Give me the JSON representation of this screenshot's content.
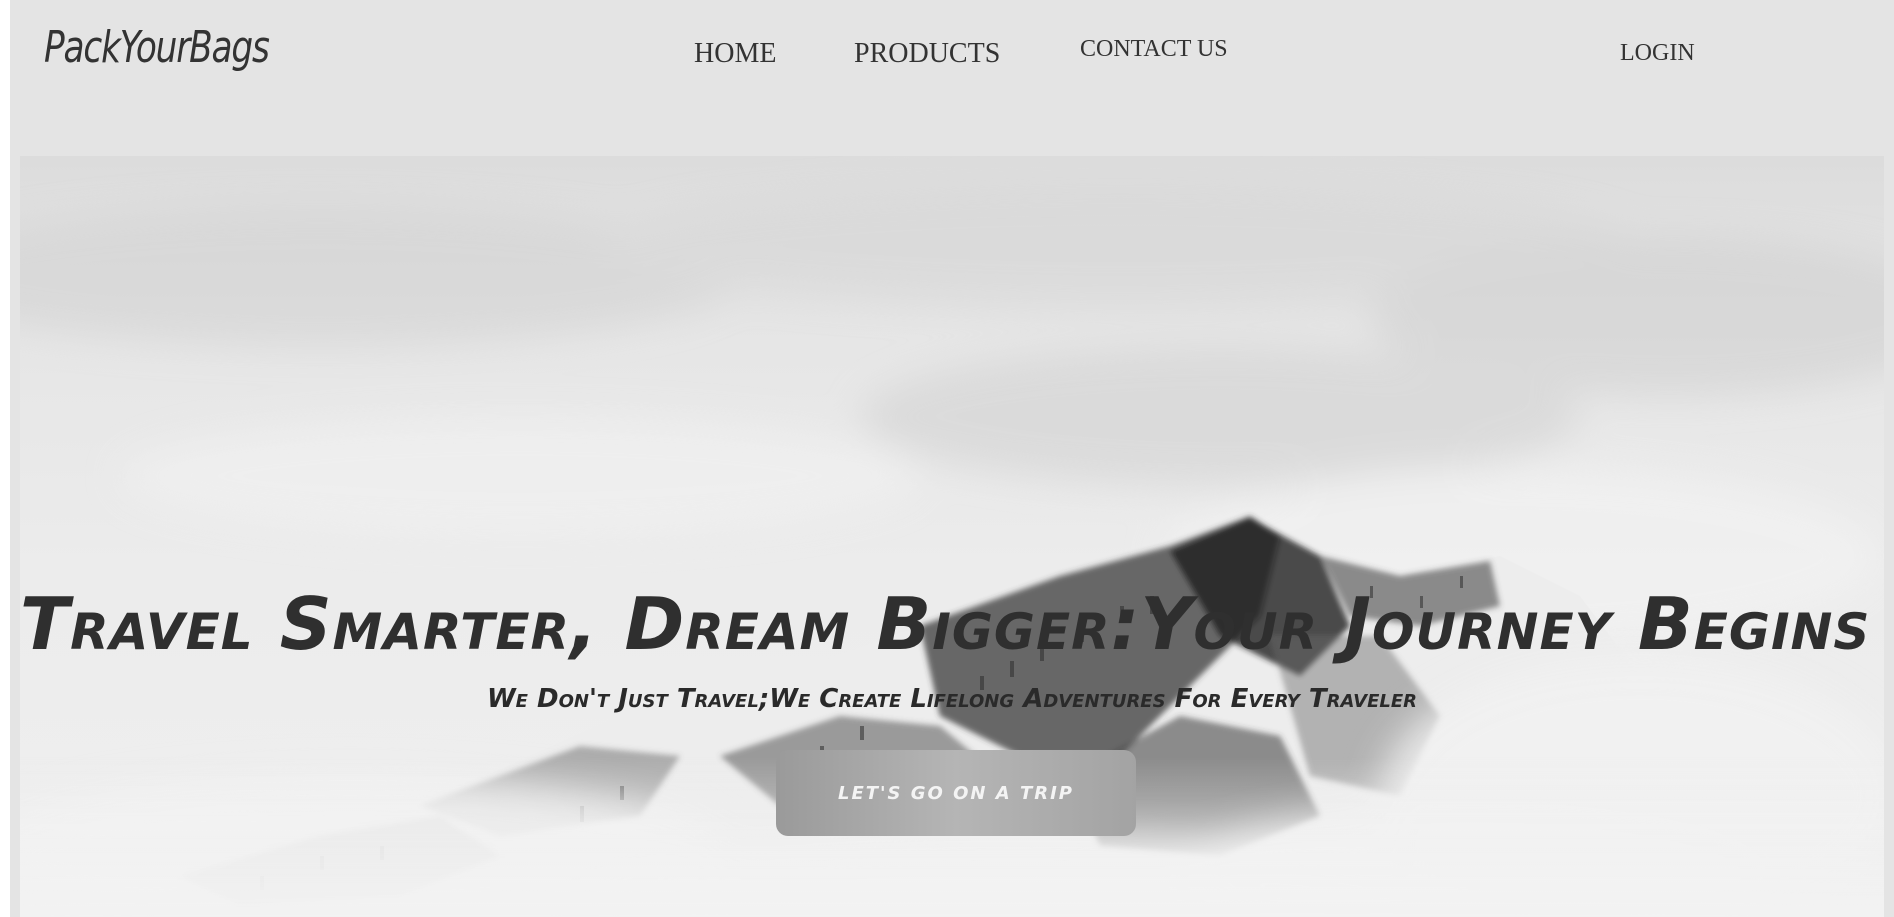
{
  "header": {
    "logo": "PackYourBags",
    "nav": {
      "home": "HOME",
      "products": "PRODUCTS",
      "contact": "CONTACT US"
    },
    "login": "LOGIN"
  },
  "hero": {
    "headline": "Travel Smarter, Dream Bigger:Your Journey Begins Here.",
    "subheadline": "We Don't Just Travel;We Create Lifelong Adventures For Every Traveler",
    "cta_label": "LET'S GO ON A TRIP",
    "background": "misty-snowy-mountain-image"
  },
  "colors": {
    "page_bg": "#e4e4e4",
    "text": "#333333",
    "button_bg": "#a8a8a8",
    "button_text": "#f4f4f4"
  }
}
